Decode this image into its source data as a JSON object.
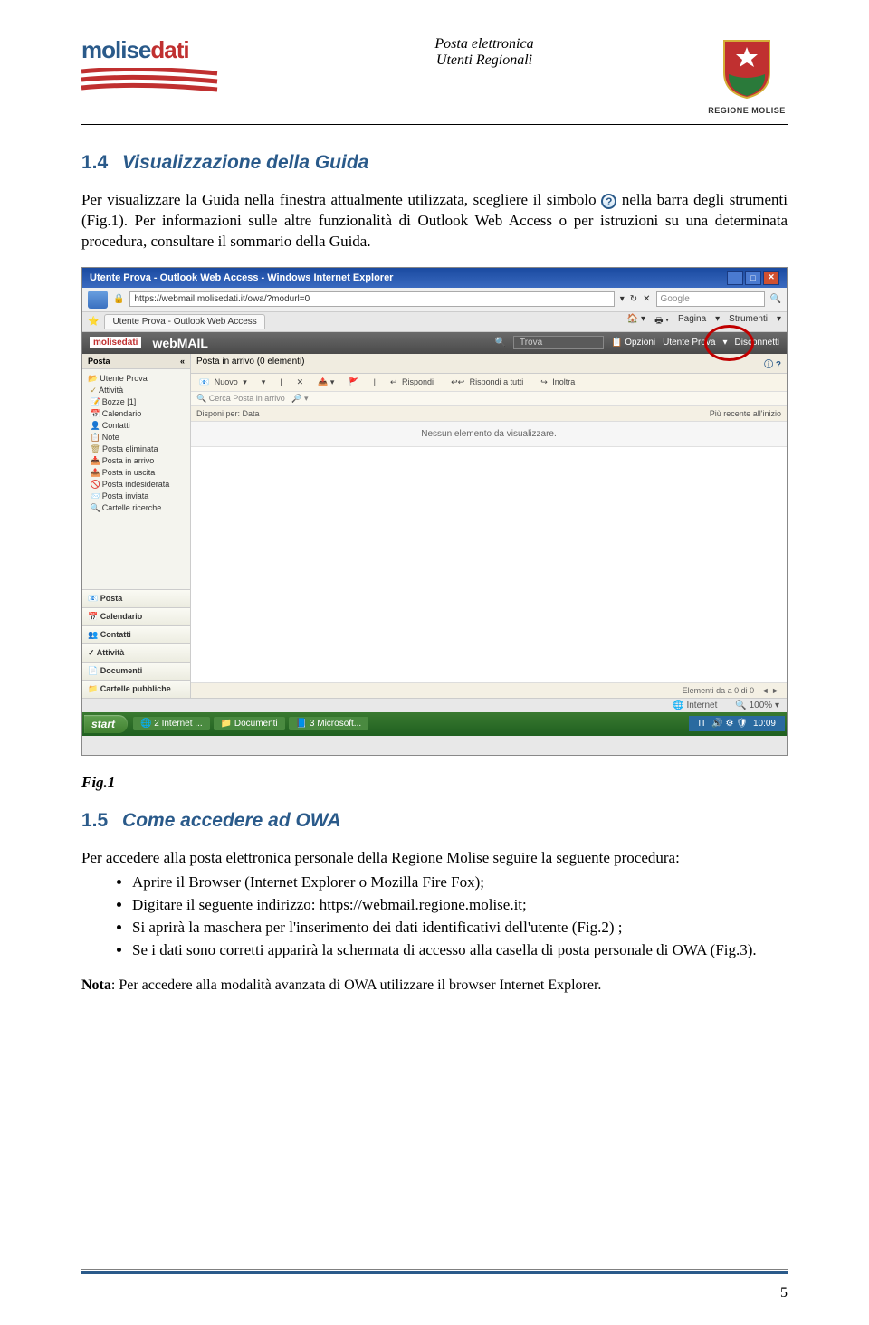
{
  "header": {
    "logo_main": "molise",
    "logo_sub": "dati",
    "center_line1": "Posta elettronica",
    "center_line2": "Utenti Regionali",
    "region_label": "REGIONE MOLISE"
  },
  "sec14": {
    "num": "1.4",
    "title": "Visualizzazione della Guida",
    "para1_a": "Per visualizzare la Guida nella finestra attualmente utilizzata, scegliere il simbolo ",
    "para1_b": " nella barra degli strumenti (Fig.1). Per informazioni sulle altre funzionalità di Outlook Web Access o per istruzioni su una determinata procedura, consultare il sommario della Guida.",
    "help_icon": "?"
  },
  "screenshot": {
    "titlebar": "Utente Prova - Outlook Web Access - Windows Internet Explorer",
    "url": "https://webmail.molisedati.it/owa/?modurl=0",
    "search_ph": "Google",
    "tab": "Utente Prova - Outlook Web Access",
    "tab_home": "Pagina",
    "tab_tools": "Strumenti",
    "owa_brand1": "molisedati",
    "owa_brand2": "webMAIL",
    "trova": "Trova",
    "opzioni": "Opzioni",
    "user": "Utente Prova",
    "disconn": "Disconnetti",
    "posta_hdr": "Posta",
    "tree": [
      "Utente Prova",
      "Attività",
      "Bozze [1]",
      "Calendario",
      "Contatti",
      "Note",
      "Posta eliminata",
      "Posta in arrivo",
      "Posta in uscita",
      "Posta indesiderata",
      "Posta inviata",
      "Cartelle ricerche"
    ],
    "navbot": [
      "Posta",
      "Calendario",
      "Contatti",
      "Attività",
      "Documenti",
      "Cartelle pubbliche"
    ],
    "main_title": "Posta in arrivo (0 elementi)",
    "help_q": "?",
    "tb_nuovo": "Nuovo",
    "tb_rispondi": "Rispondi",
    "tb_rispondi_tutti": "Rispondi a tutti",
    "tb_inoltra": "Inoltra",
    "search_ph2": "Cerca Posta in arrivo",
    "sort_l": "Disponi per: Data",
    "sort_r": "Più recente all'inizio",
    "empty": "Nessun elemento da visualizzare.",
    "pager": "Elementi da      a 0 di 0",
    "status_net": "Internet",
    "status_zoom": "100%",
    "start": "start",
    "task1": "2 Internet ...",
    "task2": "Documenti",
    "task3": "3 Microsoft...",
    "tray_lang": "IT",
    "tray_time": "10:09"
  },
  "fig1": "Fig.1",
  "sec15": {
    "num": "1.5",
    "title": "Come accedere ad OWA",
    "intro": "Per accedere alla posta elettronica personale della Regione Molise seguire la seguente procedura:",
    "b1": "Aprire il Browser (Internet Explorer o Mozilla Fire Fox);",
    "b2": "Digitare il seguente indirizzo: https://webmail.regione.molise.it;",
    "b3": "Si aprirà la maschera per l'inserimento dei dati identificativi dell'utente (Fig.2) ;",
    "b4": "Se i dati sono corretti apparirà la schermata di accesso alla casella di posta personale di OWA (Fig.3)."
  },
  "note_bold": "Nota",
  "note_text": ": Per accedere alla modalità avanzata di OWA utilizzare il browser Internet Explorer.",
  "page_number": "5"
}
